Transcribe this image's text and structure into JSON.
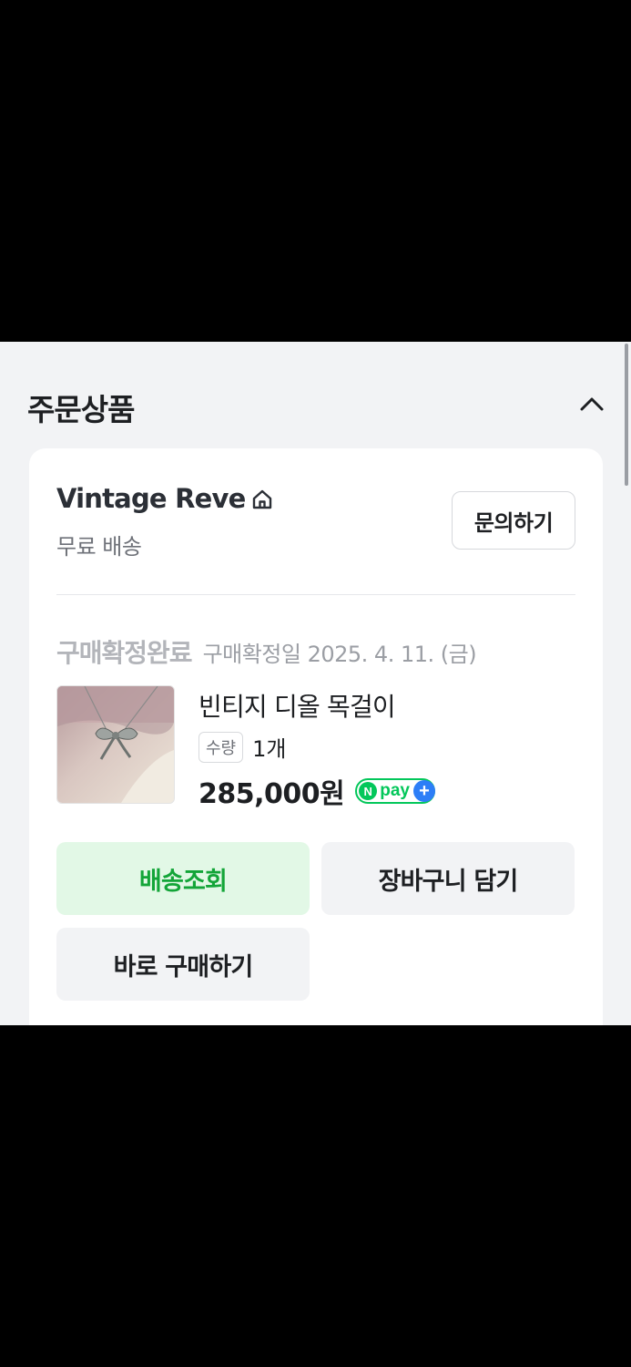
{
  "section": {
    "title": "주문상품",
    "collapse_icon": "chevron-up-icon"
  },
  "store": {
    "name": "Vintage Reve",
    "home_icon": "home-icon",
    "shipping": "무료 배송",
    "inquiry_label": "문의하기"
  },
  "order": {
    "status": "구매확정완료",
    "confirm_date": "구매확정일 2025. 4. 11. (금)"
  },
  "product": {
    "name": "빈티지 디올 목걸이",
    "qty_label": "수량",
    "qty_value": "1개",
    "price": "285,000원",
    "npay": {
      "n": "N",
      "text": "pay",
      "plus": "+"
    },
    "image_icon": "bow-necklace-photo"
  },
  "actions": {
    "track": "배송조회",
    "cart": "장바구니 담기",
    "buy_now": "바로 구매하기"
  },
  "colors": {
    "accent_green": "#03c75a",
    "track_bg": "#e2f8e6",
    "track_text": "#13a538",
    "npay_plus": "#2d7ef7"
  }
}
